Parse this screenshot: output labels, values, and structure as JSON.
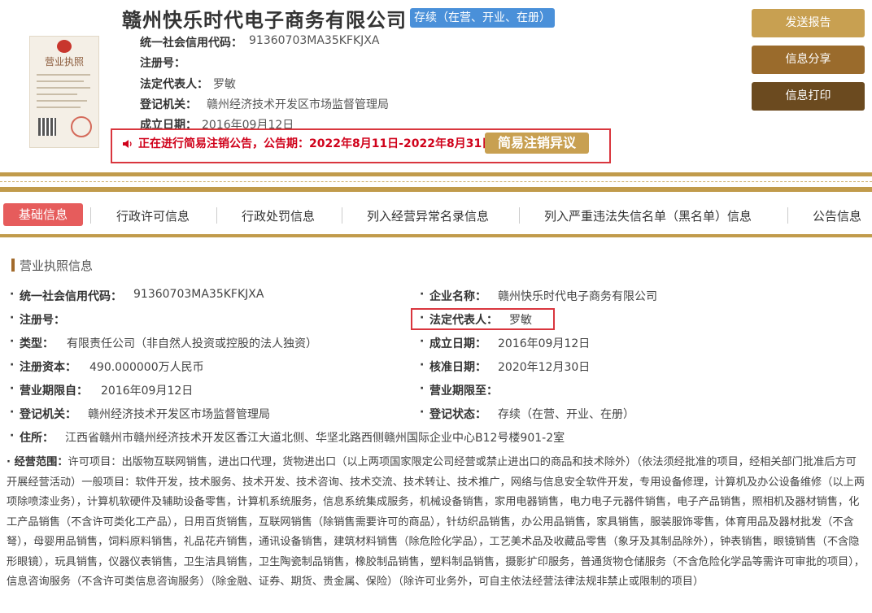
{
  "company": {
    "name": "赣州快乐时代电子商务有限公司",
    "status_badge": "存续（在营、开业、在册）"
  },
  "license_image": {
    "title": "营业执照"
  },
  "header_fields": {
    "credit_code_label": "统一社会信用代码：",
    "credit_code_value": "91360703MA35KFKJXA",
    "reg_no_label": "注册号：",
    "reg_no_value": "",
    "legal_rep_label": "法定代表人：",
    "legal_rep_value": "罗敏",
    "authority_label": "登记机关：",
    "authority_value": "赣州经济技术开发区市场监督管理局",
    "est_date_label": "成立日期：",
    "est_date_value": "2016年09月12日"
  },
  "notice": {
    "text": "正在进行简易注销公告，公告期：2022年8月11日-2022年8月31日",
    "objection_button": "简易注销异议"
  },
  "side_buttons": {
    "send_report": "发送报告",
    "share_info": "信息分享",
    "print_info": "信息打印"
  },
  "tabs": [
    "基础信息",
    "行政许可信息",
    "行政处罚信息",
    "列入经营异常名录信息",
    "列入严重违法失信名单（黑名单）信息",
    "公告信息"
  ],
  "section": {
    "title": "营业执照信息",
    "left": [
      {
        "label": "统一社会信用代码：",
        "value": "91360703MA35KFKJXA"
      },
      {
        "label": "注册号：",
        "value": ""
      },
      {
        "label": "类型：",
        "value": "有限责任公司（非自然人投资或控股的法人独资）"
      },
      {
        "label": "注册资本：",
        "value": "490.000000万人民币"
      },
      {
        "label": "营业期限自：",
        "value": "2016年09月12日"
      },
      {
        "label": "登记机关：",
        "value": "赣州经济技术开发区市场监督管理局"
      }
    ],
    "right": [
      {
        "label": "企业名称：",
        "value": "赣州快乐时代电子商务有限公司"
      },
      {
        "label": "法定代表人：",
        "value": "罗敏"
      },
      {
        "label": "成立日期：",
        "value": "2016年09月12日"
      },
      {
        "label": "核准日期：",
        "value": "2020年12月30日"
      },
      {
        "label": "营业期限至：",
        "value": ""
      },
      {
        "label": "登记状态：",
        "value": "存续（在营、开业、在册）"
      }
    ],
    "address_label": "住所：",
    "address_value": "江西省赣州市赣州经济技术开发区香江大道北侧、华坚北路西侧赣州国际企业中心B12号楼901-2室",
    "scope_label": "经营范围：",
    "scope_value": "许可项目：出版物互联网销售，进出口代理，货物进出口（以上两项国家限定公司经营或禁止进出口的商品和技术除外）（依法须经批准的项目，经相关部门批准后方可开展经营活动）一般项目：软件开发，技术服务、技术开发、技术咨询、技术交流、技术转让、技术推广，网络与信息安全软件开发，专用设备修理，计算机及办公设备维修（以上两项除喷漆业务），计算机软硬件及辅助设备零售，计算机系统服务，信息系统集成服务，机械设备销售，家用电器销售，电力电子元器件销售，电子产品销售，照相机及器材销售，化工产品销售（不含许可类化工产品），日用百货销售，互联网销售（除销售需要许可的商品），针纺织品销售，办公用品销售，家具销售，服装服饰零售，体育用品及器材批发（不含弩），母婴用品销售，饲料原料销售，礼品花卉销售，通讯设备销售，建筑材料销售（除危险化学品），工艺美术品及收藏品零售（象牙及其制品除外），钟表销售，眼镜销售（不含隐形眼镜），玩具销售，仪器仪表销售，卫生洁具销售，卫生陶瓷制品销售，橡胶制品销售，塑料制品销售，摄影扩印服务，普通货物仓储服务（不含危险化学品等需许可审批的项目），信息咨询服务（不含许可类信息咨询服务）（除金融、证券、期货、贵金属、保险）（除许可业务外，可自主依法经营法律法规非禁止或限制的项目）"
  },
  "colors": {
    "gold": "#c19b4b",
    "active_tab": "#e65c5c",
    "badge_blue": "#4a90d9",
    "notice_red": "#d0021b",
    "btn_send": "#c8a051",
    "btn_share": "#9a6b2c",
    "btn_print": "#6b4a1f"
  }
}
